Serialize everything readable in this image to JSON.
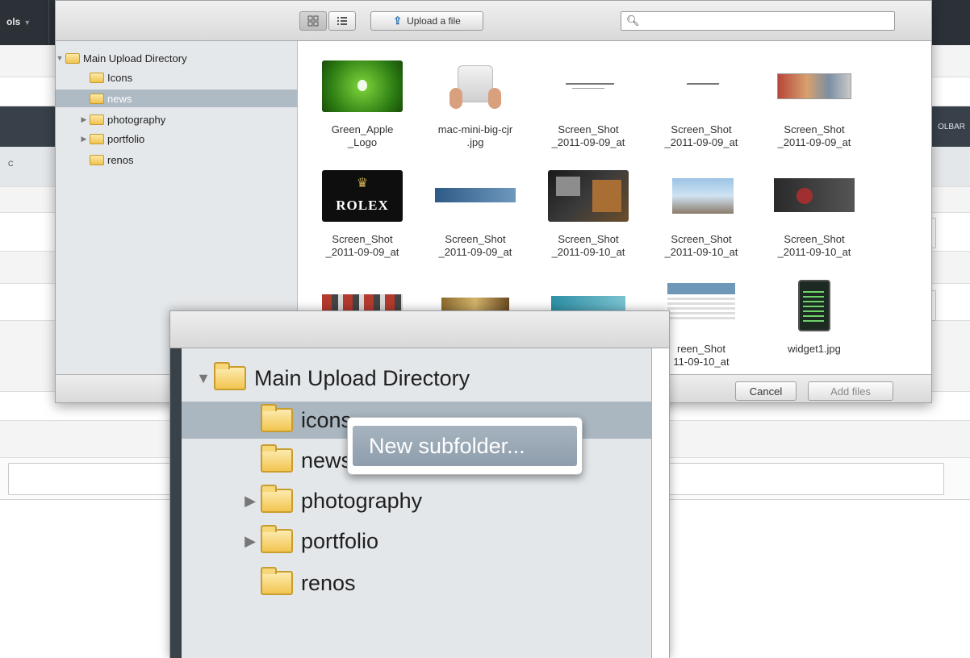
{
  "background": {
    "tools_label": "ols",
    "tools_caret": "▼",
    "toolbar_label": "OLBAR",
    "col_label": "C"
  },
  "browser": {
    "view_grid_icon": "grid-view-icon",
    "view_list_icon": "list-view-icon",
    "upload_label": "Upload a file",
    "search_placeholder": "",
    "tree": [
      {
        "label": "Main Upload Directory",
        "expanded": true,
        "level": 0
      },
      {
        "label": "Icons",
        "level": 1
      },
      {
        "label": "news",
        "level": 1,
        "selected": true
      },
      {
        "label": "photography",
        "level": 1,
        "collapsed": true
      },
      {
        "label": "portfolio",
        "level": 1,
        "collapsed": true
      },
      {
        "label": "renos",
        "level": 1
      }
    ],
    "files": [
      {
        "line1": "Green_Apple",
        "line2": "_Logo",
        "thumb": "green-apple"
      },
      {
        "line1": "mac-mini-big-cjr",
        "line2": ".jpg",
        "thumb": "mac-mini"
      },
      {
        "line1": "Screen_Shot",
        "line2": "_2011-09-09_at",
        "thumb": "signature"
      },
      {
        "line1": "Screen_Shot",
        "line2": "_2011-09-09_at",
        "thumb": "signature"
      },
      {
        "line1": "Screen_Shot",
        "line2": "_2011-09-09_at",
        "thumb": "website"
      },
      {
        "line1": "Screen_Shot",
        "line2": "_2011-09-09_at",
        "thumb": "rolex"
      },
      {
        "line1": "Screen_Shot",
        "line2": "_2011-09-09_at",
        "thumb": "banner"
      },
      {
        "line1": "Screen_Shot",
        "line2": "_2011-09-10_at",
        "thumb": "dark-photo"
      },
      {
        "line1": "Screen_Shot",
        "line2": "_2011-09-10_at",
        "thumb": "building"
      },
      {
        "line1": "Screen_Shot",
        "line2": "_2011-09-10_at",
        "thumb": "dark-card"
      },
      {
        "line1": "",
        "line2": "",
        "thumb": "collage"
      },
      {
        "line1": "",
        "line2": "",
        "thumb": "gold-banner"
      },
      {
        "line1": "",
        "line2": "",
        "thumb": "cyan-banner"
      },
      {
        "line1": "reen_Shot",
        "line2": "11-09-10_at",
        "thumb": "webpage"
      },
      {
        "line1": "widget1.jpg",
        "line2": "",
        "thumb": "phone-widget"
      }
    ],
    "rolex_text": "ROLEX",
    "cancel_label": "Cancel",
    "add_files_label": "Add files"
  },
  "zoom": {
    "root_label": "Main Upload Directory",
    "items": [
      "icons",
      "news",
      "photography",
      "portfolio",
      "renos"
    ],
    "context_menu_label": "New subfolder..."
  },
  "colors": {
    "selection": "#aebac4",
    "folder": "#f0c34e",
    "topbar": "#2b3137",
    "menu_highlight": "#98a6b4"
  }
}
